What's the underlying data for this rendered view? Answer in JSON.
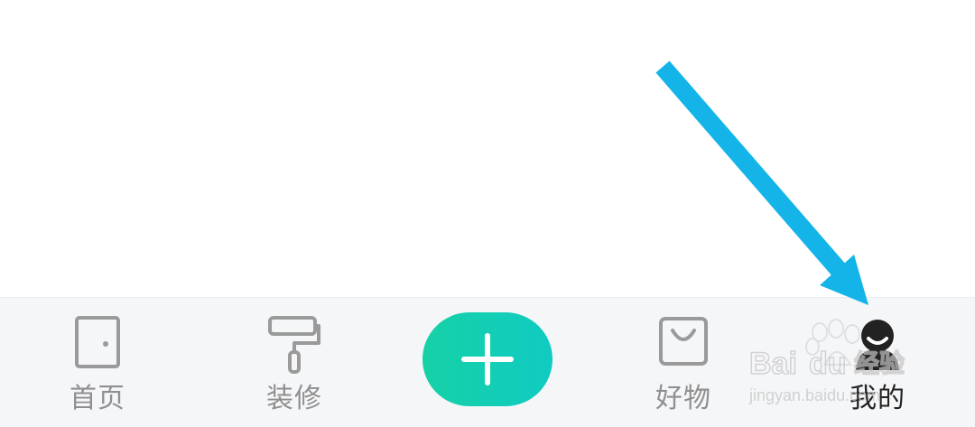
{
  "tabbar": {
    "items": [
      {
        "label": "首页",
        "icon": "door-icon",
        "active": false
      },
      {
        "label": "装修",
        "icon": "paint-roller-icon",
        "active": false
      },
      {
        "label": "好物",
        "icon": "shopping-bag-icon",
        "active": false
      },
      {
        "label": "我的",
        "icon": "user-avatar-icon",
        "active": true
      }
    ],
    "add_button": {
      "icon": "plus-icon"
    }
  },
  "colors": {
    "inactive_icon": "#9a9a9a",
    "inactive_label": "#8f8f8f",
    "active": "#222222",
    "add_button_gradient": [
      "#16d1a6",
      "#10cbc2"
    ],
    "tabbar_background": "#f5f6f8",
    "annotation_arrow": "#14b4e8"
  },
  "watermark": {
    "brand": "Baidu 经验",
    "url": "jingyan.baidu.com"
  }
}
